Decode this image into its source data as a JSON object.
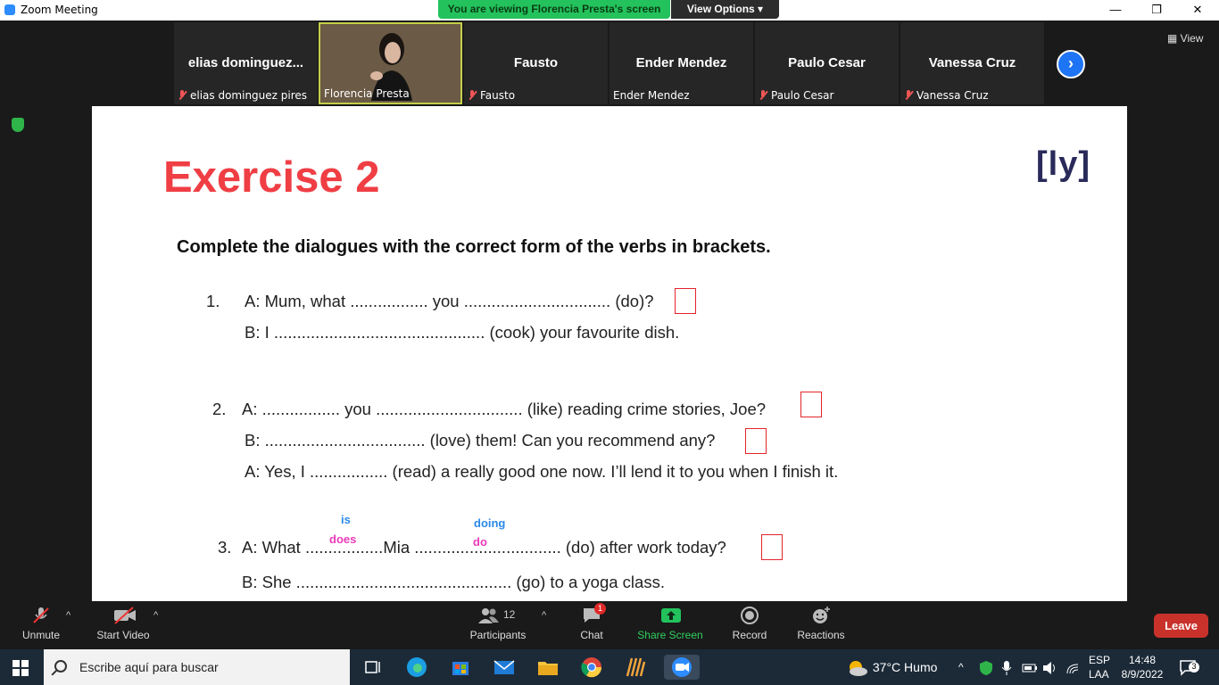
{
  "titlebar": {
    "title": "Zoom Meeting",
    "viewing": "You are viewing Florencia Presta's screen",
    "view_options": "View Options ▾",
    "minimize": "—",
    "maximize": "❐",
    "close": "✕"
  },
  "participants_strip": {
    "view_label": "View",
    "tiles": [
      {
        "big": "elias  dominguez...",
        "label": "elias dominguez pires",
        "muted": true
      },
      {
        "big": "",
        "label": "Florencia Presta",
        "muted": false,
        "video": true
      },
      {
        "big": "Fausto",
        "label": "Fausto",
        "muted": true
      },
      {
        "big": "Ender Mendez",
        "label": "Ender Mendez",
        "muted": false
      },
      {
        "big": "Paulo Cesar",
        "label": "Paulo Cesar",
        "muted": true
      },
      {
        "big": "Vanessa Cruz",
        "label": "Vanessa Cruz",
        "muted": true
      }
    ],
    "next_icon": "›"
  },
  "slide": {
    "title": "Exercise 2",
    "logo": "[ly]",
    "instruction": "Complete the dialogues with the correct form of the verbs in brackets.",
    "q1": {
      "num": "1.",
      "a": "A: Mum, what ................. you ................................ (do)?",
      "b": "B: I .............................................. (cook) your favourite dish."
    },
    "q2": {
      "num": "2.",
      "a": "A: ................. you ................................ (like) reading crime stories, Joe?",
      "b": "B:  ................................... (love) them! Can you recommend any?",
      "c": "A: Yes, I ................. (read) a really good one now. I’ll lend it to you when I finish it."
    },
    "q3": {
      "num": "3.",
      "a": "A: What .................Mia ................................ (do) after work today?",
      "b": "B: She ............................................... (go) to a yoga class."
    },
    "notes": {
      "is": "is",
      "does": "does",
      "doing": "doing",
      "do": "do"
    }
  },
  "controls": {
    "unmute": "Unmute",
    "start_video": "Start Video",
    "participants": "Participants",
    "participants_count": "12",
    "chat": "Chat",
    "chat_badge": "1",
    "share_screen": "Share Screen",
    "record": "Record",
    "reactions": "Reactions",
    "leave": "Leave"
  },
  "taskbar": {
    "search_placeholder": "Escribe aquí para buscar",
    "weather": "37°C  Humo",
    "lang_top": "ESP",
    "lang_bottom": "LAA",
    "time": "14:48",
    "date": "8/9/2022",
    "notif_count": "3"
  },
  "colors": {
    "title_red": "#ef3e44",
    "green_pill": "#23c25c",
    "leave_red": "#c8322b",
    "note_blue": "#2b8ae8",
    "note_pink": "#ea3bb8"
  }
}
